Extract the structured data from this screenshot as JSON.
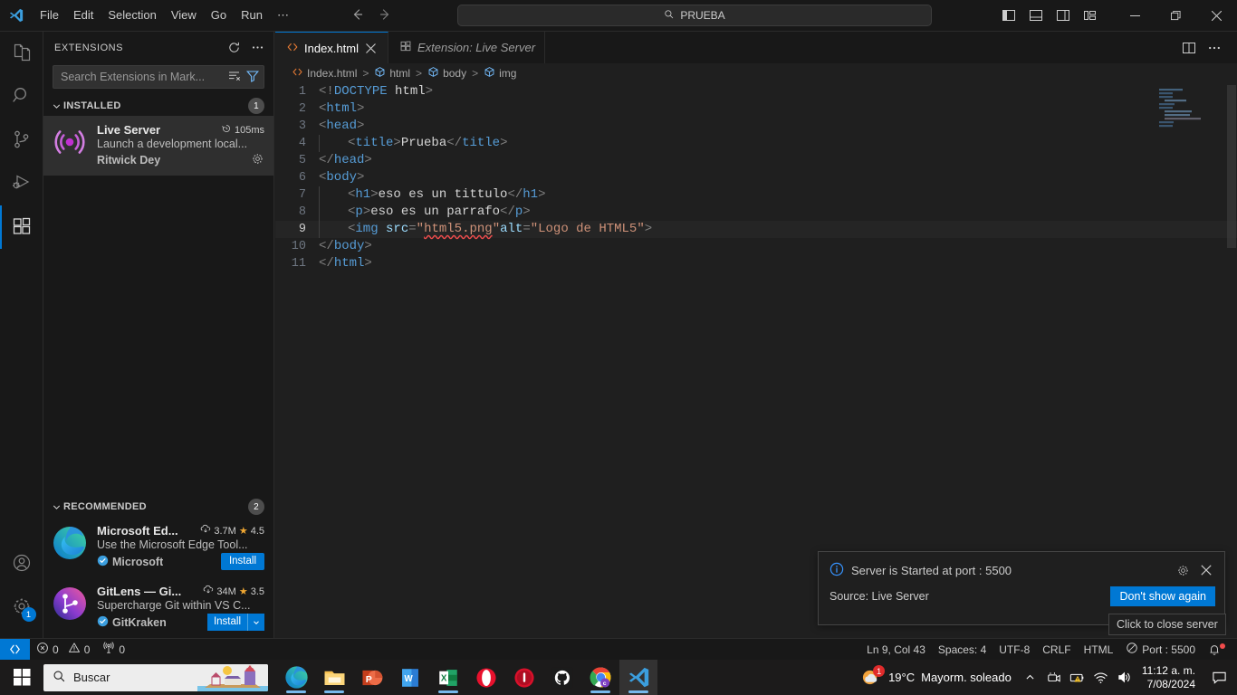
{
  "titlebar": {
    "logo_icon": "vscode-logo-icon",
    "menus": [
      "File",
      "Edit",
      "Selection",
      "View",
      "Go",
      "Run",
      "⋯"
    ],
    "back_icon": "arrow-left-icon",
    "forward_icon": "arrow-right-icon",
    "quickpick_text": "PRUEBA",
    "quickpick_icon": "search-icon",
    "layout_buttons": [
      "toggle-primary-sidebar-icon",
      "toggle-panel-icon",
      "toggle-secondary-sidebar-icon",
      "customize-layout-icon"
    ],
    "window_controls": [
      "minimize",
      "maximize",
      "close"
    ]
  },
  "activitybar": {
    "items": [
      {
        "name": "explorer",
        "icon": "files-icon",
        "active": false
      },
      {
        "name": "search",
        "icon": "search-icon",
        "active": false
      },
      {
        "name": "source-control",
        "icon": "source-control-icon",
        "active": false
      },
      {
        "name": "run-debug",
        "icon": "run-debug-icon",
        "active": false
      },
      {
        "name": "extensions",
        "icon": "extensions-icon",
        "active": true
      }
    ],
    "account_icon": "account-icon",
    "settings_icon": "gear-icon",
    "settings_badge": "1"
  },
  "sidebar": {
    "title": "EXTENSIONS",
    "refresh_icon": "refresh-icon",
    "more_icon": "more-actions-icon",
    "search_placeholder": "Search Extensions in Mark...",
    "search_value": "",
    "clear_icon": "clear-filter-icon",
    "filter_icon": "filter-icon",
    "sections": [
      {
        "label": "INSTALLED",
        "count": "1",
        "items": [
          {
            "name": "Live Server",
            "icon": "live-server-icon",
            "meta": "105ms",
            "meta_icon": "activation-time-icon",
            "description": "Launch a development local...",
            "publisher": "Ritwick Dey",
            "verified": false,
            "action": "gear",
            "action_label": "",
            "selected": true
          }
        ]
      },
      {
        "label": "RECOMMENDED",
        "count": "2",
        "items": [
          {
            "name": "Microsoft Ed...",
            "icon": "edge-icon",
            "installs": "3.7M",
            "installs_icon": "download-icon",
            "rating": "4.5",
            "rating_icon": "star-icon",
            "description": "Use the Microsoft Edge Tool...",
            "publisher": "Microsoft",
            "verified": true,
            "action": "install",
            "action_label": "Install",
            "selected": false
          },
          {
            "name": "GitLens — Gi...",
            "icon": "gitlens-icon",
            "installs": "34M",
            "installs_icon": "download-icon",
            "rating": "3.5",
            "rating_icon": "star-icon",
            "description": "Supercharge Git within VS C...",
            "publisher": "GitKraken",
            "verified": true,
            "action": "install-split",
            "action_label": "Install",
            "selected": false
          }
        ]
      }
    ]
  },
  "editor": {
    "tabs": [
      {
        "label": "Index.html",
        "icon": "html-file-icon",
        "active": true,
        "italic": false,
        "closable": true
      },
      {
        "label": "Extension: Live Server",
        "icon": "extensions-icon",
        "active": false,
        "italic": true,
        "closable": false
      }
    ],
    "tab_actions": [
      "split-editor-icon",
      "more-actions-icon"
    ],
    "breadcrumb": [
      {
        "label": "Index.html",
        "icon": "html-file-icon"
      },
      {
        "label": "html",
        "icon": "symbol-field-icon"
      },
      {
        "label": "body",
        "icon": "symbol-field-icon"
      },
      {
        "label": "img",
        "icon": "symbol-field-icon"
      }
    ],
    "code_lines": [
      {
        "n": "1",
        "indent": 0,
        "guide": false,
        "current": false,
        "tokens": [
          {
            "t": "punc",
            "v": "<!"
          },
          {
            "t": "doctype",
            "v": "DOCTYPE"
          },
          {
            "t": "txt",
            "v": " "
          },
          {
            "t": "txt",
            "v": "html"
          },
          {
            "t": "punc",
            "v": ">"
          }
        ]
      },
      {
        "n": "2",
        "indent": 0,
        "guide": false,
        "current": false,
        "tokens": [
          {
            "t": "punc",
            "v": "<"
          },
          {
            "t": "tag",
            "v": "html"
          },
          {
            "t": "punc",
            "v": ">"
          }
        ]
      },
      {
        "n": "3",
        "indent": 0,
        "guide": false,
        "current": false,
        "tokens": [
          {
            "t": "punc",
            "v": "<"
          },
          {
            "t": "tag",
            "v": "head"
          },
          {
            "t": "punc",
            "v": ">"
          }
        ]
      },
      {
        "n": "4",
        "indent": 1,
        "guide": true,
        "current": false,
        "tokens": [
          {
            "t": "punc",
            "v": "<"
          },
          {
            "t": "tag",
            "v": "title"
          },
          {
            "t": "punc",
            "v": ">"
          },
          {
            "t": "txt",
            "v": "Prueba"
          },
          {
            "t": "punc",
            "v": "</"
          },
          {
            "t": "tag",
            "v": "title"
          },
          {
            "t": "punc",
            "v": ">"
          }
        ]
      },
      {
        "n": "5",
        "indent": 0,
        "guide": false,
        "current": false,
        "tokens": [
          {
            "t": "punc",
            "v": "</"
          },
          {
            "t": "tag",
            "v": "head"
          },
          {
            "t": "punc",
            "v": ">"
          }
        ]
      },
      {
        "n": "6",
        "indent": 0,
        "guide": false,
        "current": false,
        "tokens": [
          {
            "t": "punc",
            "v": "<"
          },
          {
            "t": "tag",
            "v": "body"
          },
          {
            "t": "punc",
            "v": ">"
          }
        ]
      },
      {
        "n": "7",
        "indent": 1,
        "guide": true,
        "current": false,
        "tokens": [
          {
            "t": "punc",
            "v": "<"
          },
          {
            "t": "tag",
            "v": "h1"
          },
          {
            "t": "punc",
            "v": ">"
          },
          {
            "t": "txt",
            "v": "eso es un tittulo"
          },
          {
            "t": "punc",
            "v": "</"
          },
          {
            "t": "tag",
            "v": "h1"
          },
          {
            "t": "punc",
            "v": ">"
          }
        ]
      },
      {
        "n": "8",
        "indent": 1,
        "guide": true,
        "current": false,
        "tokens": [
          {
            "t": "punc",
            "v": "<"
          },
          {
            "t": "tag",
            "v": "p"
          },
          {
            "t": "punc",
            "v": ">"
          },
          {
            "t": "txt",
            "v": "eso es un parrafo"
          },
          {
            "t": "punc",
            "v": "</"
          },
          {
            "t": "tag",
            "v": "p"
          },
          {
            "t": "punc",
            "v": ">"
          }
        ]
      },
      {
        "n": "9",
        "indent": 1,
        "guide": true,
        "current": true,
        "tokens": [
          {
            "t": "punc",
            "v": "<"
          },
          {
            "t": "tag",
            "v": "img"
          },
          {
            "t": "txt",
            "v": " "
          },
          {
            "t": "attr",
            "v": "src"
          },
          {
            "t": "punc",
            "v": "="
          },
          {
            "t": "str",
            "v": "\""
          },
          {
            "t": "str-err",
            "v": "html5.png"
          },
          {
            "t": "str",
            "v": "\""
          },
          {
            "t": "attr",
            "v": "alt"
          },
          {
            "t": "punc",
            "v": "="
          },
          {
            "t": "str",
            "v": "\"Logo de HTML5\""
          },
          {
            "t": "punc",
            "v": ">"
          }
        ]
      },
      {
        "n": "10",
        "indent": 0,
        "guide": false,
        "current": false,
        "tokens": [
          {
            "t": "punc",
            "v": "</"
          },
          {
            "t": "tag",
            "v": "body"
          },
          {
            "t": "punc",
            "v": ">"
          }
        ]
      },
      {
        "n": "11",
        "indent": 0,
        "guide": false,
        "current": false,
        "tokens": [
          {
            "t": "punc",
            "v": "</"
          },
          {
            "t": "tag",
            "v": "html"
          },
          {
            "t": "punc",
            "v": ">"
          }
        ]
      }
    ]
  },
  "notification": {
    "icon": "info-icon",
    "message": "Server is Started at port : 5500",
    "gear_icon": "gear-icon",
    "close_icon": "close-icon",
    "source": "Source: Live Server",
    "button_label": "Don't show again"
  },
  "tooltip": {
    "text": "Click to close server"
  },
  "statusbar": {
    "remote_icon": "remote-indicator-icon",
    "left_items": [
      {
        "name": "errors",
        "icon": "error-icon",
        "value": "0"
      },
      {
        "name": "warnings",
        "icon": "warning-icon",
        "value": "0"
      },
      {
        "name": "ports",
        "icon": "radio-tower-icon",
        "value": "0"
      }
    ],
    "right_items": [
      {
        "name": "cursor-position",
        "label": "Ln 9, Col 43"
      },
      {
        "name": "indentation",
        "label": "Spaces: 4"
      },
      {
        "name": "encoding",
        "label": "UTF-8"
      },
      {
        "name": "eol",
        "label": "CRLF"
      },
      {
        "name": "language-mode",
        "label": "HTML"
      },
      {
        "name": "live-server-port",
        "label": "Port : 5500",
        "icon": "circle-slash-icon"
      },
      {
        "name": "notifications-bell",
        "label": "",
        "icon": "bell-dot-icon"
      }
    ]
  },
  "taskbar": {
    "start_icon": "windows-start-icon",
    "search_placeholder": "Buscar",
    "search_icon": "search-icon",
    "apps": [
      {
        "name": "microsoft-edge",
        "icon": "edge-icon",
        "running": true,
        "active": false
      },
      {
        "name": "file-explorer",
        "icon": "folder-icon",
        "running": true,
        "active": false
      },
      {
        "name": "powerpoint",
        "icon": "powerpoint-icon",
        "running": false,
        "active": false
      },
      {
        "name": "word",
        "icon": "word-icon",
        "running": false,
        "active": false
      },
      {
        "name": "excel",
        "icon": "excel-icon",
        "running": true,
        "active": false
      },
      {
        "name": "opera",
        "icon": "opera-icon",
        "running": false,
        "active": false
      },
      {
        "name": "opera-gx",
        "icon": "opera-gx-icon",
        "running": false,
        "active": false
      },
      {
        "name": "github-desktop",
        "icon": "github-icon",
        "running": false,
        "active": false
      },
      {
        "name": "google-chrome",
        "icon": "chrome-icon",
        "running": true,
        "active": false
      },
      {
        "name": "visual-studio-code",
        "icon": "vscode-icon",
        "running": true,
        "active": true
      }
    ],
    "tray": {
      "weather_icon": "weather-sun-cloud-icon",
      "weather_badge": "1",
      "temperature": "19°C",
      "condition": "Mayorm. soleado",
      "chevron_icon": "chevron-up-icon",
      "icons": [
        "camera-icon",
        "battery-warning-icon",
        "wifi-icon",
        "volume-icon"
      ],
      "time": "11:12 a. m.",
      "date": "7/08/2024",
      "action_center_icon": "notification-center-icon"
    }
  },
  "colors": {
    "accent": "#0078d4",
    "editor_bg": "#1f1f1f",
    "chrome_bg": "#181818",
    "tag": "#569cd6",
    "string": "#ce9178",
    "attribute": "#9cdcfe",
    "error": "#f14c4c",
    "star": "#f0a732"
  }
}
